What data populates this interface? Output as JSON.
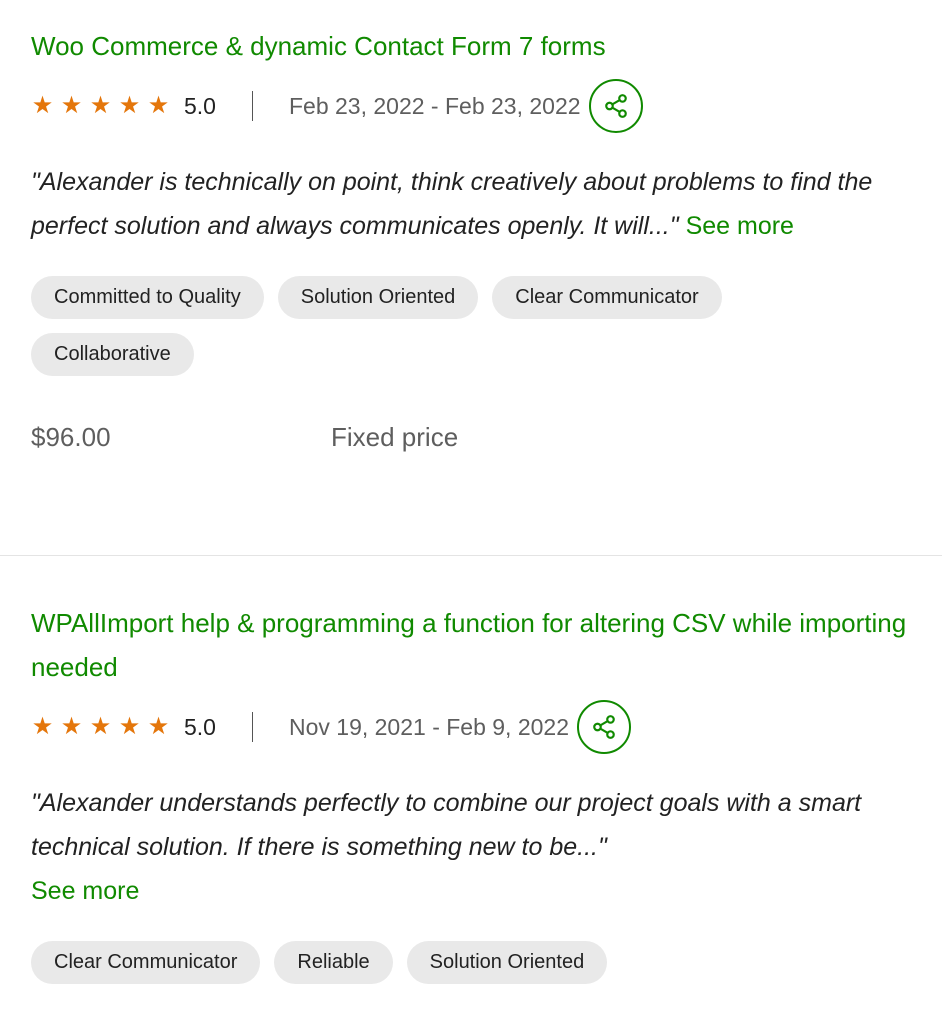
{
  "colors": {
    "accent": "#108a00",
    "star": "#e4760b",
    "chip_bg": "#e9e9e9",
    "muted": "#5e5e5e"
  },
  "icons": {
    "star": "star-icon",
    "share": "share-icon"
  },
  "reviews": [
    {
      "title": "Woo Commerce & dynamic Contact Form 7 forms",
      "stars": 5,
      "rating": "5.0",
      "dates": "Feb 23, 2022 - Feb 23, 2022",
      "quote": "\"Alexander is technically on point, think creatively about problems to find the perfect solution and always communicates openly. It will...\"",
      "see_more": "See more",
      "tags": [
        "Committed to Quality",
        "Solution Oriented",
        "Clear Communicator",
        "Collaborative"
      ],
      "amount": "$96.00",
      "price_type": "Fixed price"
    },
    {
      "title": "WPAllImport help & programming a function for altering CSV while importing needed",
      "stars": 5,
      "rating": "5.0",
      "dates": "Nov 19, 2021 - Feb 9, 2022",
      "quote": "\"Alexander understands perfectly to combine our project goals with a smart technical solution. If there is something new to be...\"",
      "see_more": "See more",
      "tags": [
        "Clear Communicator",
        "Reliable",
        "Solution Oriented"
      ]
    }
  ]
}
